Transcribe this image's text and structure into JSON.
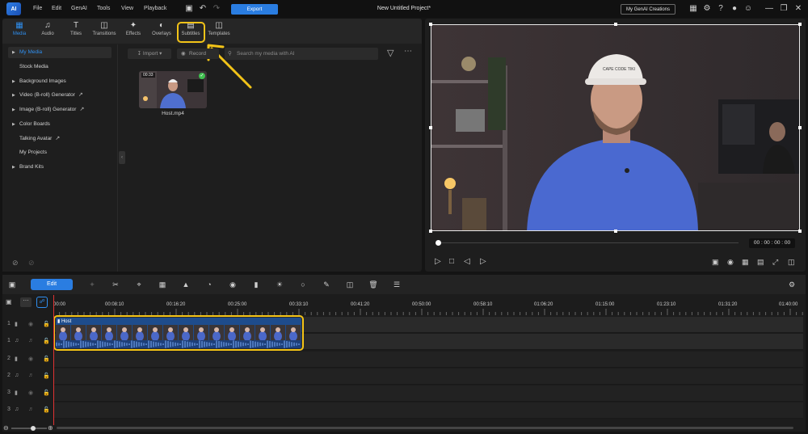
{
  "titlebar": {
    "logo_text": "AI",
    "menus": [
      "File",
      "Edit",
      "GenAI",
      "Tools",
      "View",
      "Playback"
    ],
    "export_label": "Export",
    "project_title": "New Untitled Project*",
    "genai_creations_label": "My GenAI Creations"
  },
  "room_tabs": [
    {
      "label": "Media",
      "icon": "media-icon"
    },
    {
      "label": "Audio",
      "icon": "music-note-icon"
    },
    {
      "label": "Titles",
      "icon": "text-icon"
    },
    {
      "label": "Transitions",
      "icon": "transition-icon"
    },
    {
      "label": "Effects",
      "icon": "effects-icon"
    },
    {
      "label": "Overlays",
      "icon": "overlay-icon"
    },
    {
      "label": "Subtitles",
      "icon": "subtitles-icon"
    },
    {
      "label": "Templates",
      "icon": "templates-icon"
    }
  ],
  "sidebar": {
    "items": [
      {
        "label": "My Media"
      },
      {
        "label": "Stock Media"
      },
      {
        "label": "Background Images"
      },
      {
        "label": "Video (B-roll) Generator"
      },
      {
        "label": "Image (B-roll) Generator"
      },
      {
        "label": "Color Boards"
      },
      {
        "label": "Talking Avatar"
      },
      {
        "label": "My Projects"
      },
      {
        "label": "Brand Kits"
      }
    ]
  },
  "library": {
    "import_label": "Import",
    "record_label": "Record",
    "search_placeholder": "Search my media with AI",
    "clip": {
      "name": "Host.mp4",
      "duration": "00:33"
    }
  },
  "preview": {
    "timecode": "00 : 00 : 00 : 00",
    "cap_text": "CAPE CODE TIKI"
  },
  "timeline": {
    "edit_label": "Edit",
    "ruler_ticks": [
      "00:00",
      "00:08:10",
      "00:16:20",
      "00:25:00",
      "00:33:10",
      "00:41:20",
      "00:50:00",
      "00:58:10",
      "01:06:20",
      "01:15:00",
      "01:23:10",
      "01:31:20",
      "01:40:00"
    ],
    "clip_label": "Host"
  },
  "colors": {
    "accent": "#2a7de1",
    "highlight": "#f2c318",
    "playhead": "#e03333"
  }
}
